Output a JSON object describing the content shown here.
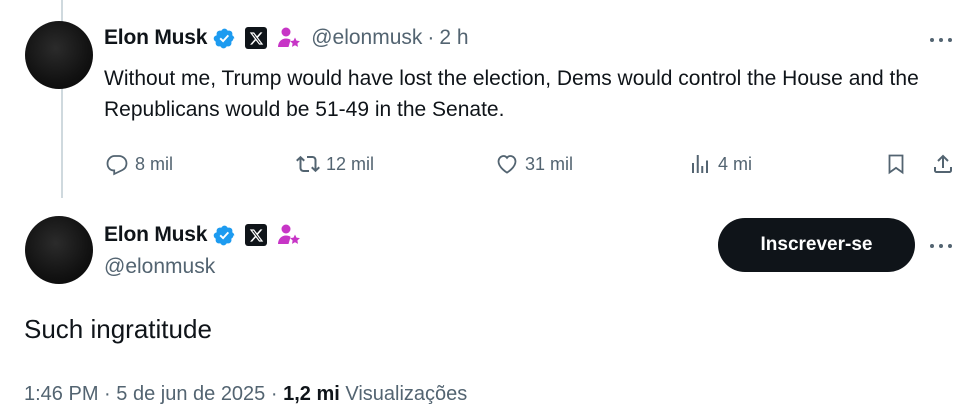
{
  "parent_tweet": {
    "display_name": "Elon Musk",
    "handle": "@elonmusk",
    "separator": "·",
    "time_ago": "2 h",
    "text": "Without me, Trump would have lost the election, Dems would control the House and the Republicans would be 51-49 in the Senate.",
    "actions": {
      "replies": "8 mil",
      "reposts": "12 mil",
      "likes": "31 mil",
      "views": "4 mi"
    }
  },
  "main_tweet": {
    "display_name": "Elon Musk",
    "handle": "@elonmusk",
    "subscribe_label": "Inscrever-se",
    "text": "Such ingratitude",
    "time": "1:46 PM",
    "date": "5 de jun de 2025",
    "separator": "·",
    "views_count": "1,2 mi",
    "views_label": "Visualizações"
  },
  "icons": {
    "verified": "verified-badge-icon",
    "affiliate": "x-logo-badge-icon",
    "gov": "person-star-icon",
    "more": "more-dots-icon",
    "reply": "reply-icon",
    "repost": "repost-icon",
    "like": "heart-icon",
    "views": "views-bar-icon",
    "bookmark": "bookmark-icon",
    "share": "share-icon"
  },
  "colors": {
    "verified_blue": "#1d9bf0",
    "muted_text": "#536471",
    "primary_text": "#0f1419",
    "affiliate_purple": "#c735c6",
    "button_bg": "#0f1419"
  }
}
